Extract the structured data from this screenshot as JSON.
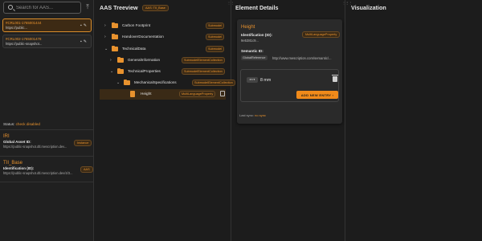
{
  "search": {
    "placeholder": "Search for AAS..."
  },
  "shells": [
    {
      "id": "#CRL001-1765001444",
      "url": "https://public...",
      "selected": true
    },
    {
      "id": "#CRL002-1765001478",
      "url": "https://public-snapshot...",
      "selected": false
    }
  ],
  "status": {
    "label": "Status:",
    "value": "check disabled"
  },
  "assets": [
    {
      "title": "IRI",
      "label": "Global Asset ID:",
      "value": "https://public-snapshot.dtl.mescription.dev...",
      "badge": "Instance"
    },
    {
      "title": "TII_Base",
      "label": "Identification (ID):",
      "value": "https://public-snapshot.dtl.mescription.dev/4/3...",
      "badge": "AAS"
    }
  ],
  "tree": {
    "title": "AAS Treeview",
    "tab_label": "AAS: TII_Base",
    "rows": [
      {
        "label": "Carbon Footprint",
        "tag": "Submodel"
      },
      {
        "label": "HandoverDocumentation",
        "tag": "Submodel"
      },
      {
        "label": "TechnicalData",
        "tag": "Submodel"
      },
      {
        "label": "GeneralInformation",
        "tag": "SubmodelElementCollection"
      },
      {
        "label": "TechnicalProperties",
        "tag": "SubmodelElementCollection"
      },
      {
        "label": "MechanicalSpecifications",
        "tag": "SubmodelElementCollection"
      },
      {
        "label": "Height",
        "tag": "MultiLanguageProperty"
      }
    ]
  },
  "details": {
    "title": "Element Details",
    "name": "Height",
    "badge": "MultiLanguageProperty",
    "id_label": "Identification (ID):",
    "id_value": "9e5381c9...",
    "semantic_label": "Semantic ID:",
    "semantic_chip": "GlobalReference",
    "semantic_value": "http://www.mescription.com/semantic/...",
    "lang": "en",
    "value": "8 mm",
    "add_label": "ADD NEW ENTRY",
    "last_sync_label": "Last sync:",
    "last_sync_value": "no sync"
  },
  "viz": {
    "title": "Visualization"
  },
  "colors": {
    "accent": "#e8922e",
    "button": "#f08a1a",
    "background": "#1c1c1c",
    "card": "#2a2a2a"
  },
  "icons": [
    "search-icon",
    "upload-icon",
    "delete-icon",
    "edit-icon",
    "chevron-right-icon",
    "chevron-down-icon",
    "folder-icon",
    "document-icon",
    "copy-icon",
    "trash-icon",
    "drag-handle-icon"
  ]
}
